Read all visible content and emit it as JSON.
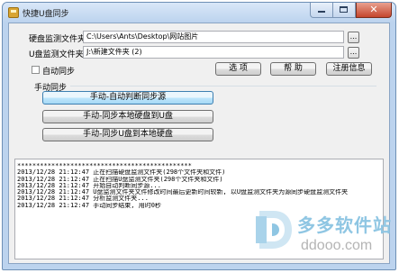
{
  "window": {
    "title": "快捷U盘同步",
    "close_glyph": "✕"
  },
  "settings": {
    "disk_folder_label": "硬盘监测文件夹",
    "disk_folder_value": "C:\\Users\\Ants\\Desktop\\网站图片",
    "usb_folder_label": "U盘监测文件夹",
    "usb_folder_value": "J:\\新建文件夹 (2)",
    "browse_label": "..."
  },
  "options": {
    "auto_sync_label": "自动同步",
    "auto_sync_checked": false,
    "options_button": "选 项",
    "help_button": "帮 助",
    "register_button": "注册信息"
  },
  "manual": {
    "group_label": "手动同步",
    "auto_detect_button": "手动-自动判断同步源",
    "disk_to_usb_button": "手动-同步本地硬盘到U盘",
    "usb_to_disk_button": "手动-同步U盘到本地硬盘"
  },
  "log": {
    "lines": [
      "**********************************************",
      "2013/12/28 21:12:47  正在扫描硬盘监测文件夹(298个文件夹和文件)",
      "2013/12/28 21:12:47  正在扫描U盘监测文件夹(298个文件夹和文件)",
      "2013/12/28 21:12:47  开始自动判断同步源...",
      "2013/12/28 21:12:47  U盘监测文件夹文件修改时间最后更新时间较新, 以U盘监测文件夹为源同步硬盘监测文件夹",
      "2013/12/28 21:12:47  分析监测文件夹...",
      "2013/12/28 21:12:47  手动同步结束, 用时0秒"
    ]
  },
  "watermark": {
    "cn_text": "多多软件站",
    "url_text": "ddooo.com"
  },
  "colors": {
    "title_bar": "#bcd3ee",
    "close_button": "#c5452d",
    "watermark_blue": "#8fc6e3"
  }
}
